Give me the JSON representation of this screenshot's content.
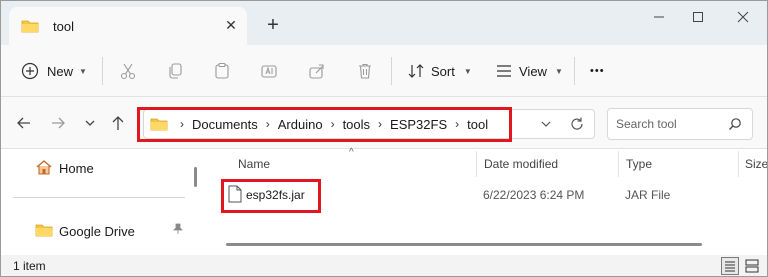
{
  "tab": {
    "title": "tool",
    "close_glyph": "✕",
    "new_tab_glyph": "+"
  },
  "window": {
    "minimize_glyph": "—",
    "maximize_glyph": "☐",
    "close_glyph": "✕"
  },
  "toolbar": {
    "new_label": "New",
    "sort_label": "Sort",
    "view_label": "View",
    "more_glyph": "•••",
    "dropdown_glyph": "⌄"
  },
  "address": {
    "crumbs": [
      "Documents",
      "Arduino",
      "tools",
      "ESP32FS",
      "tool"
    ],
    "separator": "›",
    "dropdown_glyph": "⌄"
  },
  "search": {
    "placeholder": "Search tool"
  },
  "sidebar": {
    "items": [
      {
        "label": "Home",
        "icon": "home-icon"
      },
      {
        "label": "Google Drive",
        "icon": "folder-icon"
      }
    ]
  },
  "filelist": {
    "columns": [
      "Name",
      "Date modified",
      "Type",
      "Size"
    ],
    "sort_glyph": "^",
    "rows": [
      {
        "name": "esp32fs.jar",
        "date": "6/22/2023 6:24 PM",
        "type": "JAR File"
      }
    ]
  },
  "status": {
    "count": "1 item"
  },
  "colors": {
    "highlight": "#e2161d",
    "folder": "#f4c542",
    "accent": "#0a64c8"
  }
}
